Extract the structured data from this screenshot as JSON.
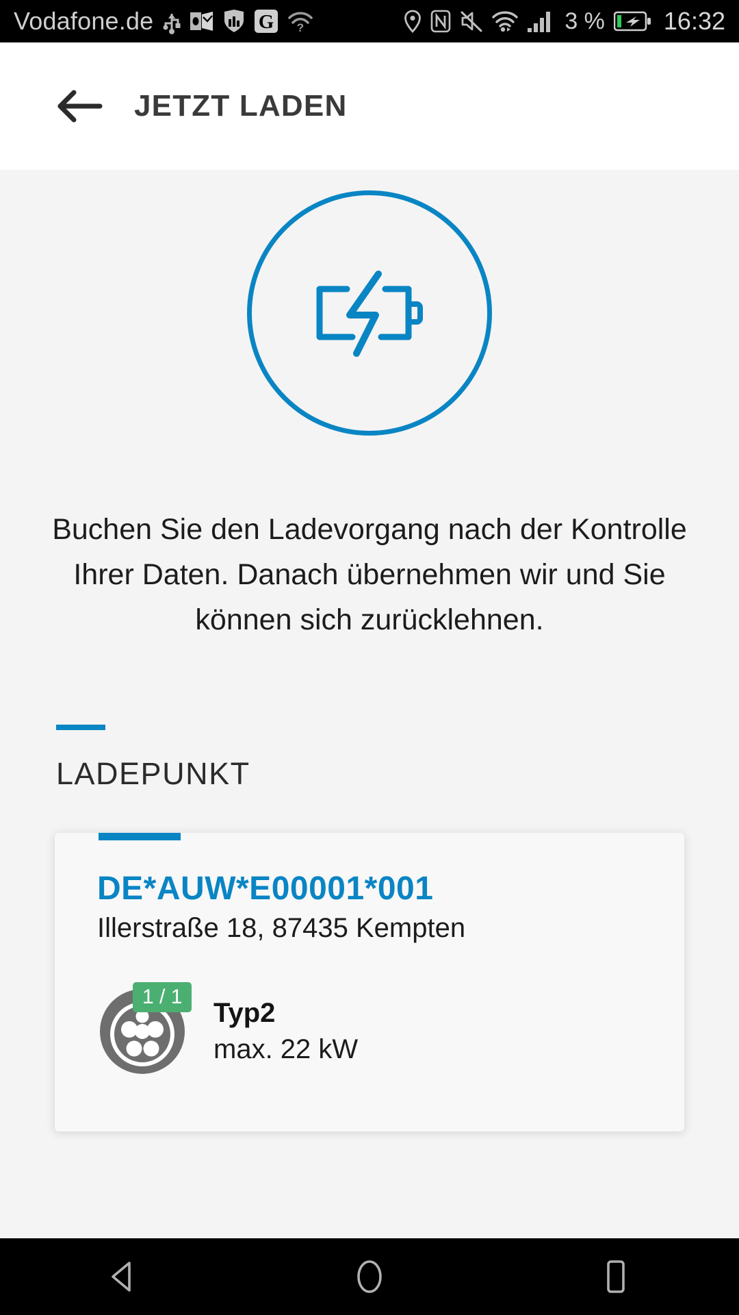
{
  "status_bar": {
    "carrier": "Vodafone.de",
    "battery_percent": "3 %",
    "time": "16:32",
    "left_icons": [
      "usb-icon",
      "outlook-icon",
      "shield-icon",
      "google-icon",
      "wifi-question-icon"
    ],
    "right_icons": [
      "location-icon",
      "nfc-icon",
      "mute-icon",
      "wifi-icon",
      "signal-icon"
    ],
    "battery_state": "charging"
  },
  "header": {
    "title": "JETZT LADEN",
    "back_label": "Zurück"
  },
  "hero": {
    "icon": "battery-charging-icon",
    "accent_color": "#0a85c4"
  },
  "intro": {
    "text": "Buchen Sie den Ladevorgang nach der Kontrolle Ihrer Daten. Danach übernehmen wir und Sie können sich zurücklehnen."
  },
  "section": {
    "title": "LADEPUNKT"
  },
  "charge_point": {
    "id": "DE*AUW*E00001*001",
    "address": "Illerstraße 18, 87435 Kempten",
    "connector": {
      "icon": "type2-connector-icon",
      "availability": "1 / 1",
      "availability_color": "#4caf72",
      "name": "Typ2",
      "power": "max. 22 kW"
    }
  },
  "nav_bar": {
    "back": "back-triangle-icon",
    "home": "home-circle-icon",
    "recents": "recents-square-icon"
  }
}
